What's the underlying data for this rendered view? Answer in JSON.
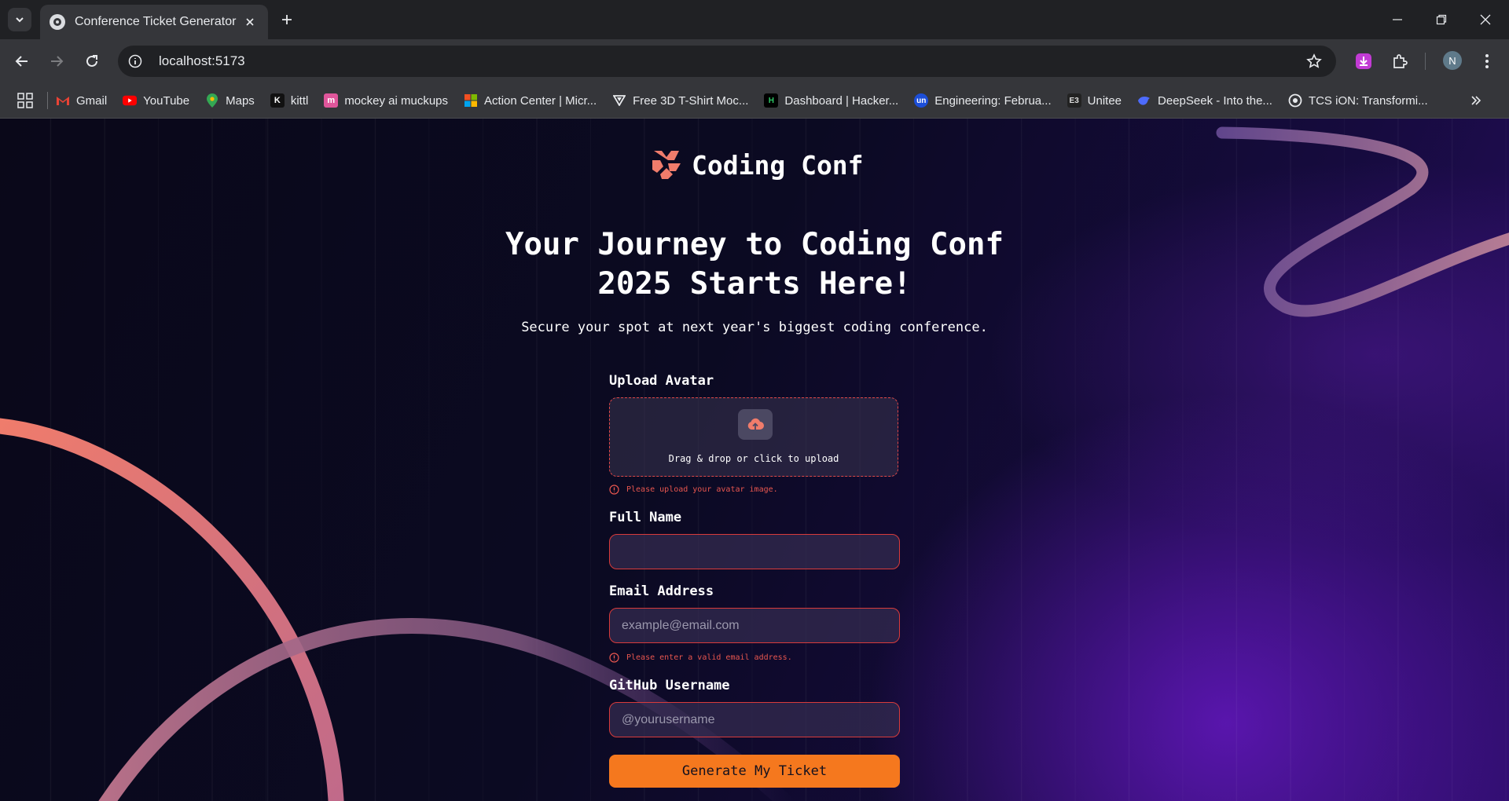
{
  "browser": {
    "tab_title": "Conference Ticket Generator",
    "url": "localhost:5173",
    "profile_initial": "N",
    "bookmarks": [
      {
        "label": "Gmail",
        "icon": "gmail-icon"
      },
      {
        "label": "YouTube",
        "icon": "youtube-icon"
      },
      {
        "label": "Maps",
        "icon": "maps-icon"
      },
      {
        "label": "kittl",
        "icon": "kittl-icon"
      },
      {
        "label": "mockey ai muckups",
        "icon": "mockey-icon"
      },
      {
        "label": "Action Center | Micr...",
        "icon": "microsoft-icon"
      },
      {
        "label": "Free 3D T-Shirt Moc...",
        "icon": "tshirt-icon"
      },
      {
        "label": "Dashboard | Hacker...",
        "icon": "hackerrank-icon"
      },
      {
        "label": "Engineering: Februa...",
        "icon": "unstop-icon"
      },
      {
        "label": "Unitee",
        "icon": "unitee-icon"
      },
      {
        "label": "DeepSeek - Into the...",
        "icon": "deepseek-icon"
      },
      {
        "label": "TCS iON: Transformi...",
        "icon": "tcs-icon"
      }
    ]
  },
  "page": {
    "brand": "Coding Conf",
    "headline_line1": "Your Journey to Coding Conf",
    "headline_line2": "2025 Starts Here!",
    "subheadline": "Secure your spot at next year's biggest coding conference.",
    "form": {
      "avatar_label": "Upload Avatar",
      "upload_hint": "Drag & drop or click to upload",
      "avatar_error": "Please upload your avatar image.",
      "name_label": "Full Name",
      "name_value": "",
      "email_label": "Email Address",
      "email_placeholder": "example@email.com",
      "email_error": "Please enter a valid email address.",
      "github_label": "GitHub Username",
      "github_placeholder": "@yourusername",
      "submit_label": "Generate My Ticket"
    }
  },
  "colors": {
    "accent_orange": "#f5781e",
    "error_red": "#e8564f",
    "logo_coral": "#f07c6b"
  }
}
